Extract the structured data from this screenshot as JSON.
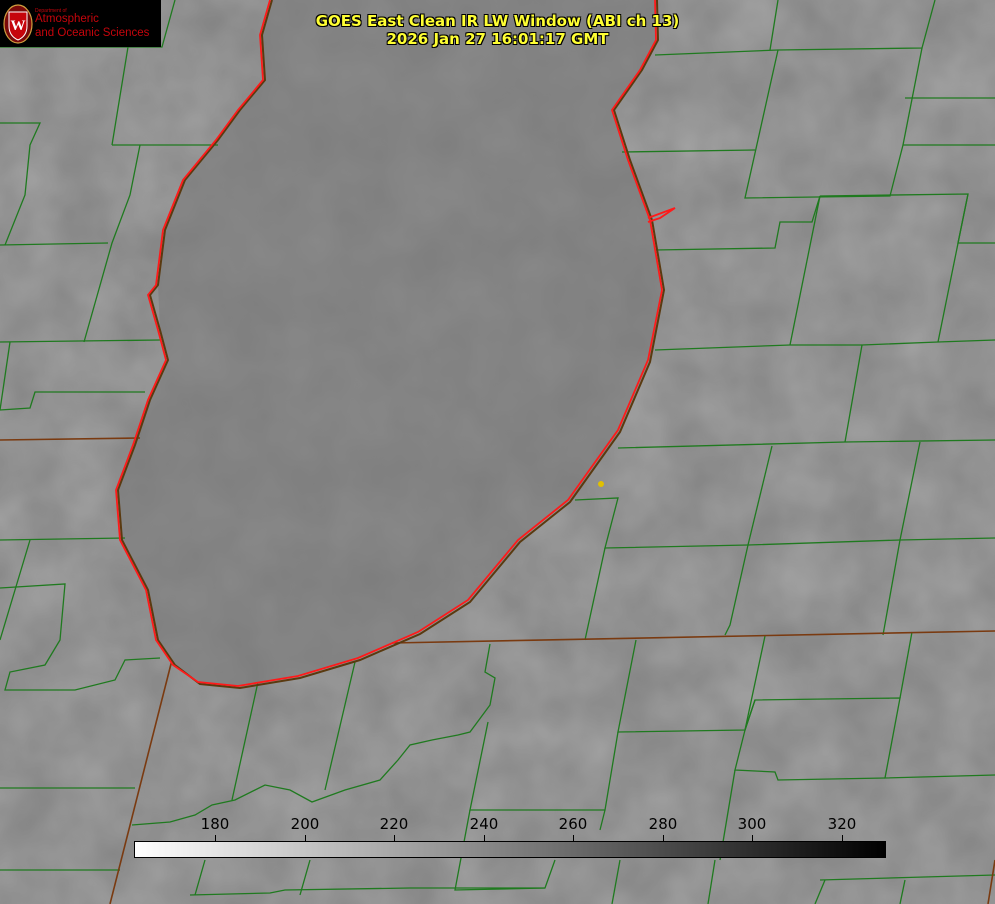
{
  "logo": {
    "department": "Department of",
    "line1": "Atmospheric",
    "line2": "and Oceanic Sciences",
    "seal_letter": "W",
    "seal_color": "#c5050c"
  },
  "title": {
    "line1": "GOES East Clean IR LW Window (ABI ch 13)",
    "line2": "2026 Jan 27 16:01:17 GMT"
  },
  "colorbar": {
    "ticks": [
      "180",
      "200",
      "220",
      "240",
      "260",
      "280",
      "300",
      "320"
    ],
    "gradient": [
      "#ffffff",
      "#000000"
    ]
  },
  "colors": {
    "background": "#808080",
    "county_border": "#1f7a1f",
    "state_border": "#7a3a10",
    "lake_shoreline": "#ff1a1a",
    "title_text": "#ffff33",
    "marker": "#e0c000"
  }
}
